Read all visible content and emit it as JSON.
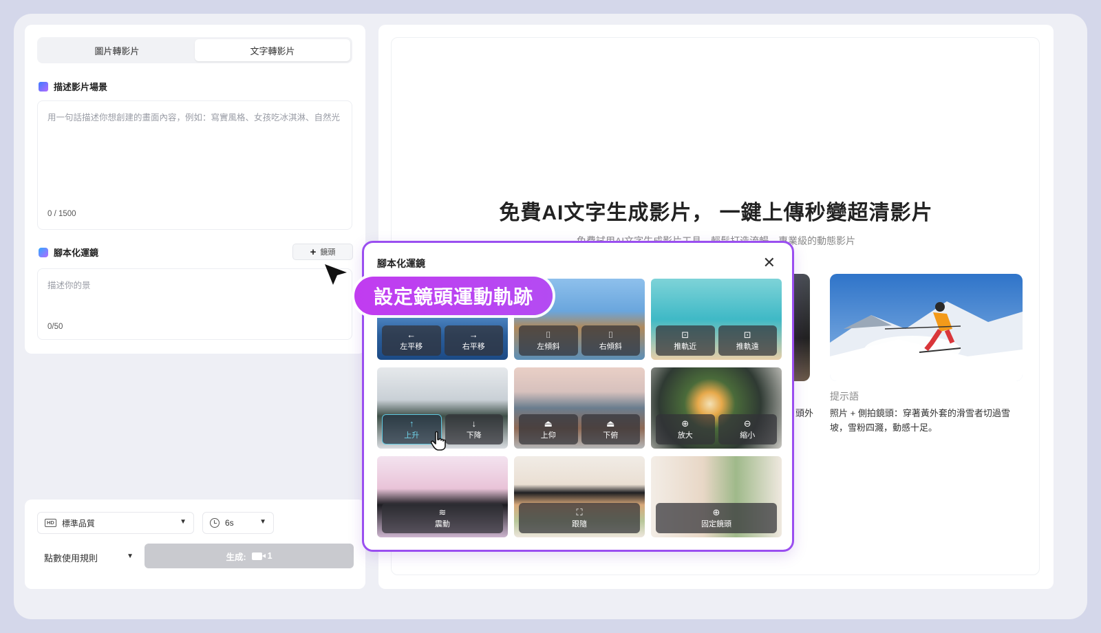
{
  "tabs": [
    {
      "label": "圖片轉影片",
      "active": false
    },
    {
      "label": "文字轉影片",
      "active": true
    }
  ],
  "describe": {
    "title": "描述影片場景",
    "placeholder": "用一句話描述你想創建的畫面內容，例如：寫實風格、女孩吃冰淇淋、自然光",
    "counter": "0 / 1500"
  },
  "script": {
    "title": "腳本化運鏡",
    "add_button": "鏡頭",
    "placeholder": "描述你的景",
    "counter": "0/50"
  },
  "bottom": {
    "quality": "標準品質",
    "duration": "6s",
    "rules": "點數使用規則",
    "generate_label": "生成:",
    "generate_cost": "1"
  },
  "hero": {
    "title": "免費AI文字生成影片， 一鍵上傳秒變超清影片",
    "subtitle": "免費試用AI文字生成影片工具，輕鬆打造流暢、專業級的動態影片"
  },
  "example": {
    "label": "提示語",
    "text": "照片 + 側拍鏡頭：穿著黃外套的滑雪者切過雪坡，雪粉四濺，動感十足。",
    "cut_text": "頭外"
  },
  "popup": {
    "title": "腳本化運鏡",
    "ribbon": "設定鏡頭運動軌跡",
    "moves": {
      "pan_left": "左平移",
      "pan_right": "右平移",
      "tilt_left": "左傾斜",
      "tilt_right": "右傾斜",
      "push_in": "推軌近",
      "pull_out": "推軌遠",
      "rise": "上升",
      "fall": "下降",
      "look_up": "上仰",
      "look_down": "下俯",
      "zoom_in": "放大",
      "zoom_out": "縮小",
      "shake": "震動",
      "follow": "跟隨",
      "fixed": "固定鏡頭"
    }
  },
  "colors": {
    "accent": "#9a4ef0",
    "ribbon": "#c13cf0",
    "selected": "#5ec8e0"
  }
}
